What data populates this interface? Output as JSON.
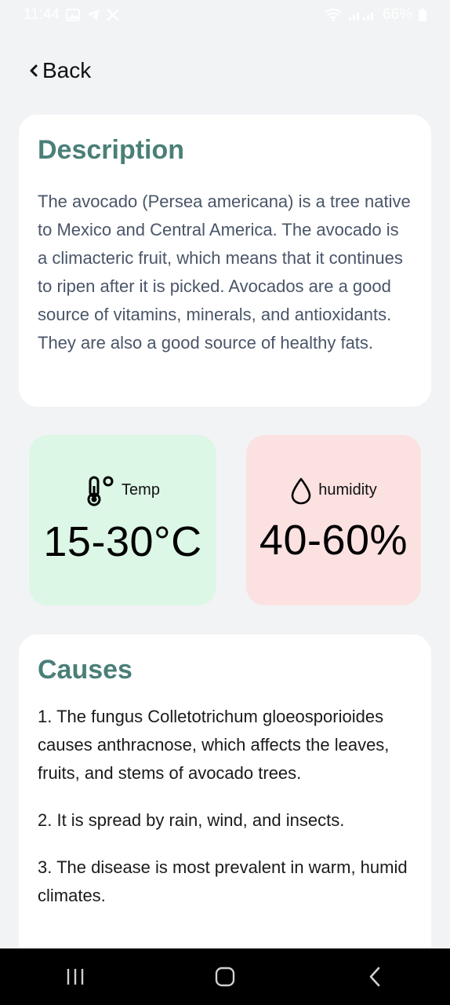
{
  "status_bar": {
    "time": "11:44",
    "battery": "66%"
  },
  "header": {
    "back_label": "Back"
  },
  "description": {
    "title": "Description",
    "text": "The avocado (Persea americana) is a tree native to Mexico and Central America. The avocado is a climacteric fruit, which means that it continues to ripen after it is picked. Avocados are a good source of vitamins, minerals, and antioxidants. They are also a good source of healthy fats."
  },
  "stats": {
    "temp": {
      "label": "Temp",
      "value": "15-30°C",
      "icon": "thermometer-icon",
      "bg": "#dcf7e6"
    },
    "humidity": {
      "label": "humidity",
      "value": "40-60%",
      "icon": "water-drop-icon",
      "bg": "#fce1e1"
    }
  },
  "causes": {
    "title": "Causes",
    "items": [
      "1. The fungus Colletotrichum gloeosporioides causes anthracnose, which affects the leaves, fruits, and stems of avocado trees.",
      "2. It is spread by rain, wind, and insects.",
      "3. The disease is most prevalent in warm, humid climates."
    ]
  },
  "colors": {
    "accent": "#4a7f78",
    "background": "#f2f3f5"
  }
}
